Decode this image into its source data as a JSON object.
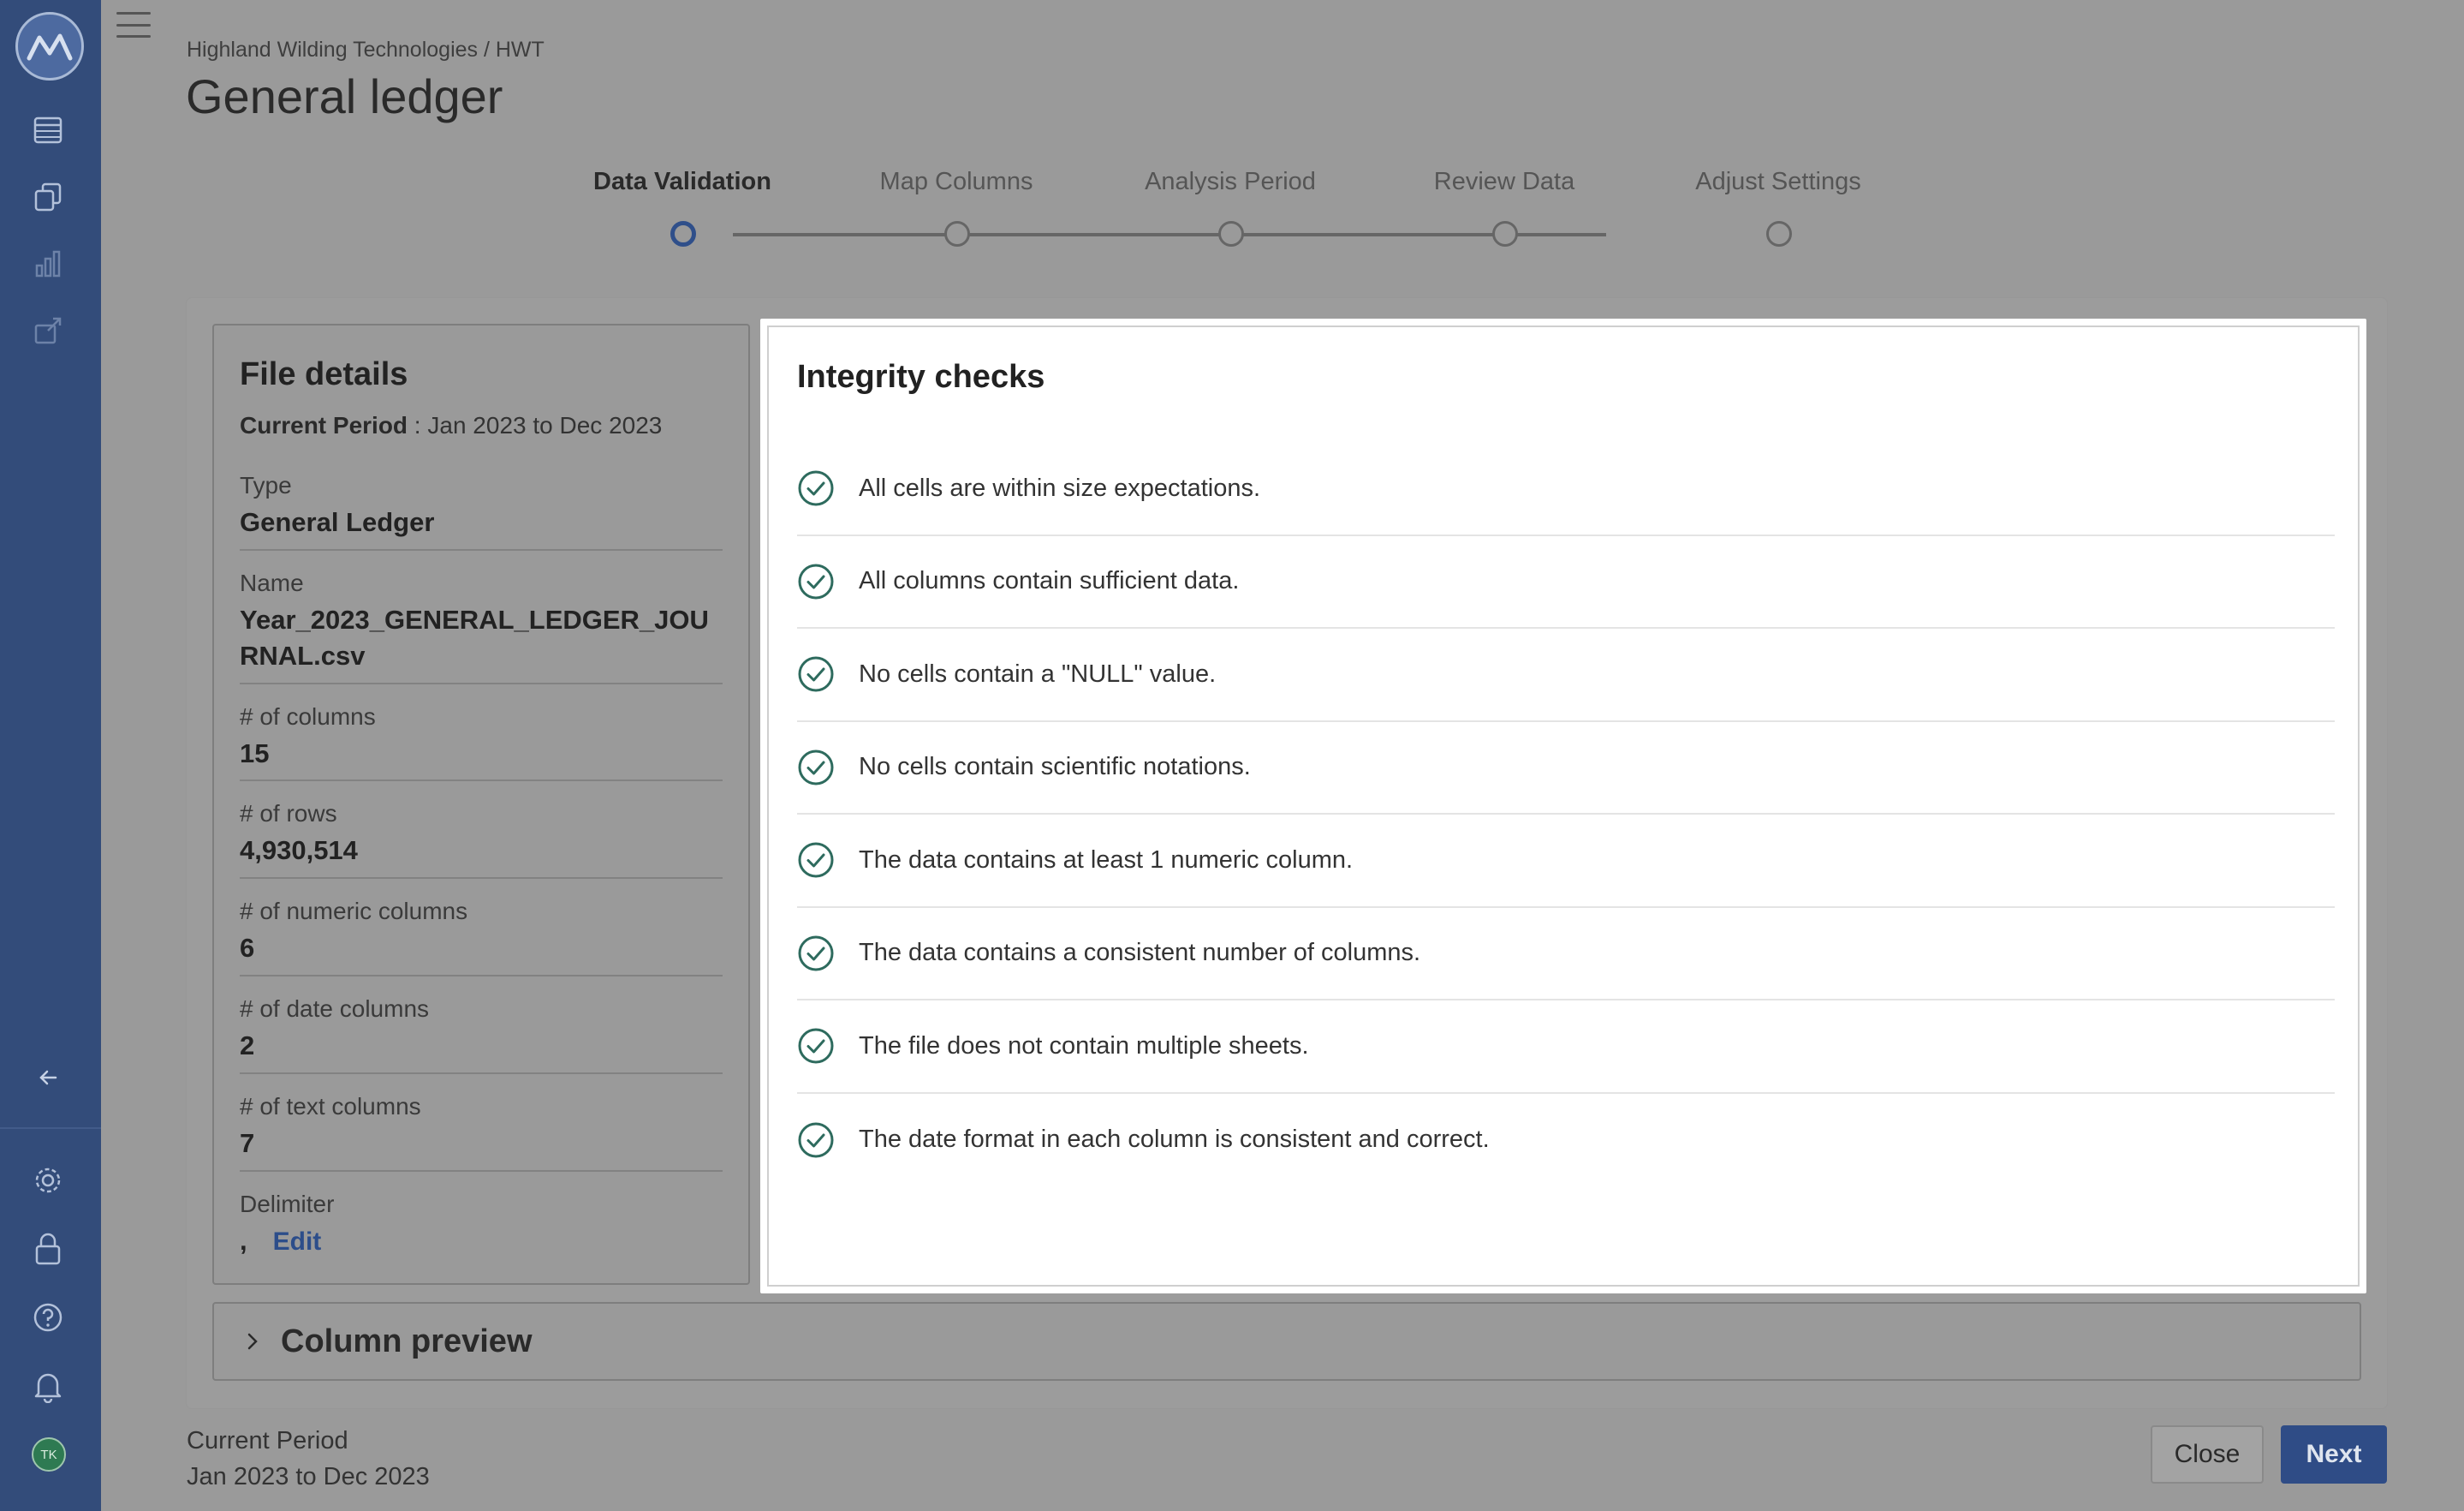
{
  "sidebar": {
    "logo": "mountain-logo",
    "nav": [
      {
        "icon": "table-icon"
      },
      {
        "icon": "copy-icon"
      },
      {
        "icon": "bar-chart-icon"
      },
      {
        "icon": "share-icon"
      }
    ],
    "collapse_icon": "arrow-left-icon",
    "bottom": [
      {
        "icon": "gear-icon"
      },
      {
        "icon": "lock-icon"
      },
      {
        "icon": "help-icon"
      },
      {
        "icon": "bell-icon"
      }
    ],
    "avatar_initials": "TK"
  },
  "header": {
    "breadcrumb": "Highland Wilding Technologies / HWT",
    "title": "General ledger"
  },
  "stepper": {
    "steps": [
      {
        "label": "Data Validation",
        "active": true
      },
      {
        "label": "Map Columns",
        "active": false
      },
      {
        "label": "Analysis Period",
        "active": false
      },
      {
        "label": "Review Data",
        "active": false
      },
      {
        "label": "Adjust Settings",
        "active": false
      }
    ]
  },
  "file_details": {
    "title": "File details",
    "period_label": "Current Period",
    "period_value": " : Jan 2023 to Dec 2023",
    "fields": [
      {
        "key": "Type",
        "value": "General Ledger"
      },
      {
        "key": "Name",
        "value": "Year_2023_GENERAL_LEDGER_JOURNAL.csv"
      },
      {
        "key": "# of columns",
        "value": "15"
      },
      {
        "key": "# of rows",
        "value": "4,930,514"
      },
      {
        "key": "# of numeric columns",
        "value": "6"
      },
      {
        "key": "# of date columns",
        "value": "2"
      },
      {
        "key": "# of text columns",
        "value": "7"
      }
    ],
    "delimiter_label": "Delimiter",
    "delimiter_value": ",",
    "edit_label": "Edit"
  },
  "integrity": {
    "title": "Integrity checks",
    "checks": [
      "All cells are within size expectations.",
      "All columns contain sufficient data.",
      "No cells contain a \"NULL\" value.",
      "No cells contain scientific notations.",
      "The data contains at least 1 numeric column.",
      "The data contains a consistent number of columns.",
      "The file does not contain multiple sheets.",
      "The date format in each column is consistent and correct."
    ],
    "check_icon": "check-circle-icon",
    "check_color": "#2e6b5e"
  },
  "column_preview": {
    "label": "Column preview"
  },
  "footer": {
    "period_label": "Current Period",
    "period_value": "Jan 2023 to Dec 2023",
    "close_label": "Close",
    "next_label": "Next"
  },
  "colors": {
    "sidebar": "#334c7a",
    "accent": "#2f4c86",
    "overlay": "#9a9a9a"
  }
}
